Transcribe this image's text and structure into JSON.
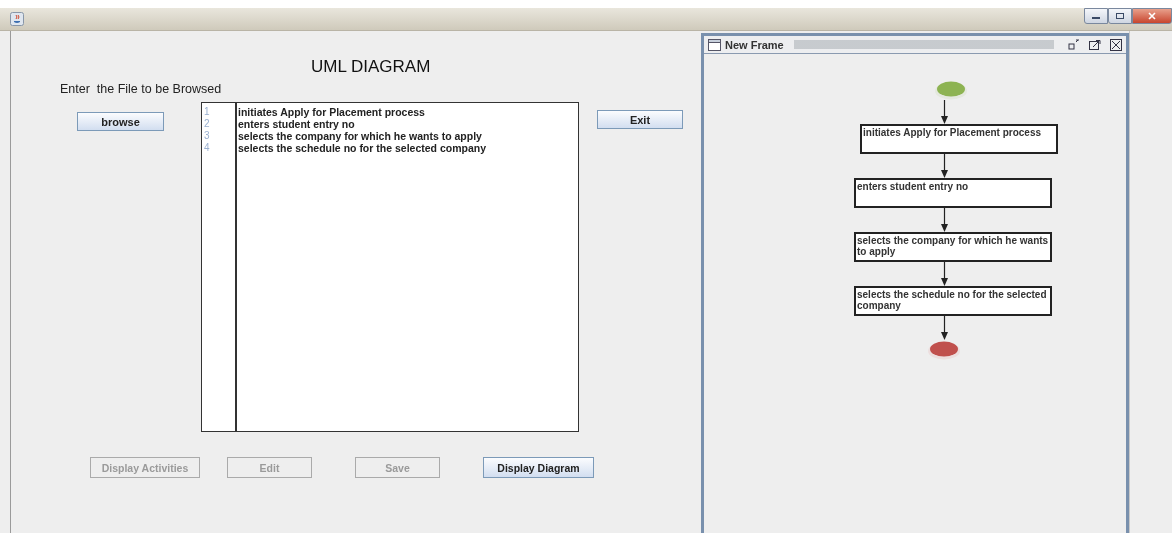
{
  "main": {
    "heading": "UML DIAGRAM",
    "prompt": "Enter  the File to be Browsed",
    "browse_button": "browse",
    "exit_button": "Exit",
    "editor_lines": [
      {
        "number": "1",
        "text": "initiates Apply for Placement process"
      },
      {
        "number": "2",
        "text": "enters student entry no"
      },
      {
        "number": "3",
        "text": "selects the company for which he wants to apply"
      },
      {
        "number": "4",
        "text": "selects the schedule no for the selected company"
      }
    ],
    "buttons": [
      {
        "label": "Display Activities",
        "disabled": true
      },
      {
        "label": "Edit",
        "disabled": true
      },
      {
        "label": "Save",
        "disabled": true
      },
      {
        "label": "Display Diagram",
        "disabled": false
      }
    ]
  },
  "internal_frame": {
    "title": "New Frame",
    "nodes": [
      {
        "kind": "start"
      },
      {
        "kind": "activity",
        "text": "initiates Apply for Placement process"
      },
      {
        "kind": "activity",
        "text": "enters student entry no"
      },
      {
        "kind": "activity",
        "text": "selects the company for which he wants to apply"
      },
      {
        "kind": "activity",
        "text": "selects the schedule no for the selected company"
      },
      {
        "kind": "end"
      }
    ]
  }
}
